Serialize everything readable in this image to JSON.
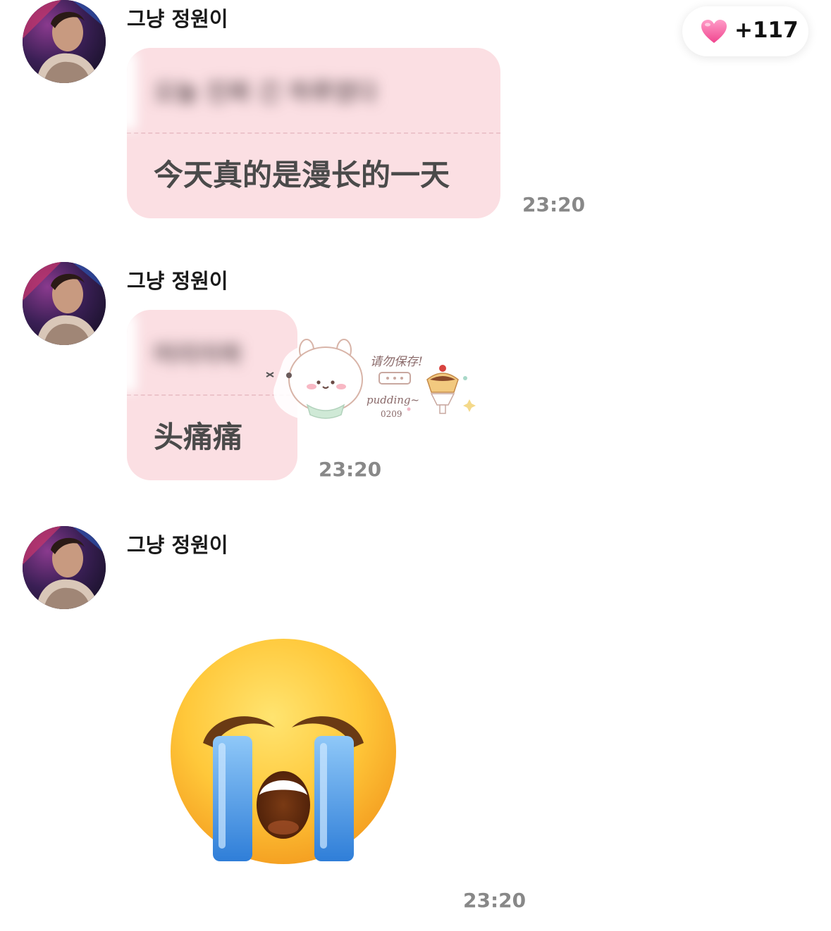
{
  "like_badge": {
    "icon": "heart-icon",
    "count": "+117"
  },
  "messages": [
    {
      "sender": "그냥 정원이",
      "quoted": "오늘 진짜 긴 하루였다",
      "text": "今天真的是漫长的一天",
      "time": "23:20"
    },
    {
      "sender": "그냥 정원이",
      "quoted": "머리아파",
      "text": "头痛痛",
      "time": "23:20",
      "sticker": {
        "icon": "bunny-pudding-sticker",
        "caption_top": "请勿保存!",
        "caption_bottom": "pudding~",
        "caption_code": "0209"
      }
    },
    {
      "sender": "그냥 정원이",
      "emoji": "loudly-crying-face-emoji",
      "time": "23:20"
    }
  ],
  "colors": {
    "bubble": "#fbdfe3",
    "time": "#888888"
  }
}
